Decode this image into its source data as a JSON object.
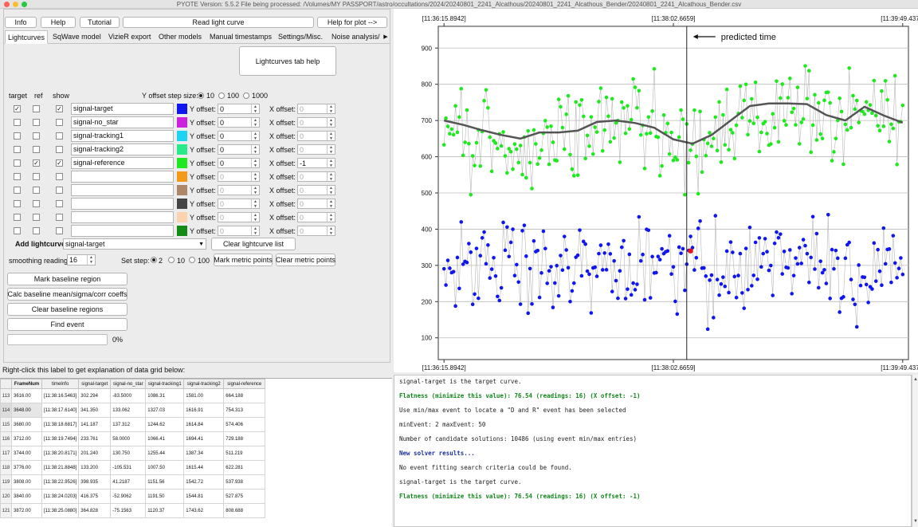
{
  "window": {
    "title": "PYOTE Version: 5.5.2  File being processed: /Volumes/MY PASSPORT/astro/occultations/2024/20240801_2241_Alcathous/20240801_2241_Alcathous_Bender/20240801_2241_Alcathous_Bender.csv"
  },
  "toolbar": {
    "info": "Info",
    "help": "Help",
    "tutorial": "Tutorial",
    "read_lc": "Read light curve",
    "help_plot": "Help for plot -->"
  },
  "tabs": [
    "Lightcurves",
    "SqWave model",
    "VizieR export",
    "Other models",
    "Manual timestamps",
    "Settings/Misc.",
    "Noise analysis/"
  ],
  "lc_help": "Lightcurves tab help",
  "headers": {
    "target": "target",
    "ref": "ref",
    "show": "show",
    "yoffset_step": "Y offset step size:",
    "yoffset_label": "Y offset:",
    "xoffset_label": "X offset:"
  },
  "yoffset_steps": [
    "10",
    "100",
    "1000"
  ],
  "curves": [
    {
      "name": "signal-target",
      "color": "#0f16ee",
      "target": true,
      "ref": false,
      "show": true,
      "yoff": "0",
      "xoff": "0",
      "enabled": true,
      "xen": false
    },
    {
      "name": "signal-no_star",
      "color": "#cc22dd",
      "target": false,
      "ref": false,
      "show": false,
      "yoff": "0",
      "xoff": "0",
      "enabled": true,
      "xen": false
    },
    {
      "name": "signal-tracking1",
      "color": "#1ed2f4",
      "target": false,
      "ref": false,
      "show": false,
      "yoff": "0",
      "xoff": "0",
      "enabled": true,
      "xen": false
    },
    {
      "name": "signal-tracking2",
      "color": "#28ea8a",
      "target": false,
      "ref": false,
      "show": false,
      "yoff": "0",
      "xoff": "0",
      "enabled": true,
      "xen": false
    },
    {
      "name": "signal-reference",
      "color": "#1ee91e",
      "target": false,
      "ref": true,
      "show": true,
      "yoff": "0",
      "xoff": "-1",
      "enabled": true,
      "xen": true
    },
    {
      "name": "",
      "color": "#f39a1a",
      "target": false,
      "ref": false,
      "show": false,
      "yoff": "0",
      "xoff": "0",
      "enabled": false,
      "xen": false
    },
    {
      "name": "",
      "color": "#ae8668",
      "target": false,
      "ref": false,
      "show": false,
      "yoff": "0",
      "xoff": "0",
      "enabled": false,
      "xen": false
    },
    {
      "name": "",
      "color": "#454545",
      "target": false,
      "ref": false,
      "show": false,
      "yoff": "0",
      "xoff": "0",
      "enabled": false,
      "xen": false
    },
    {
      "name": "",
      "color": "#fbd4ae",
      "target": false,
      "ref": false,
      "show": false,
      "yoff": "0",
      "xoff": "0",
      "enabled": false,
      "xen": false
    },
    {
      "name": "",
      "color": "#168a16",
      "target": false,
      "ref": false,
      "show": false,
      "yoff": "0",
      "xoff": "0",
      "enabled": false,
      "xen": false
    }
  ],
  "add_lc": {
    "label": "Add lightcurve",
    "value": "signal-target",
    "clear": "Clear lightcurve list"
  },
  "smoothing": {
    "label": "smoothing readings",
    "value": "16"
  },
  "set_step": {
    "label": "Set step:",
    "options": [
      "2",
      "10",
      "100"
    ]
  },
  "metric": {
    "mark": "Mark metric points",
    "clear": "Clear metric points"
  },
  "actions": {
    "mark_baseline": "Mark baseline region",
    "calc_baseline": "Calc baseline mean/sigma/corr coeffs",
    "clear_baseline": "Clear baseline regions",
    "find_event": "Find event"
  },
  "progress": {
    "text": "0%",
    "value": 0
  },
  "grid_hint": "Right-click this label to get explanation of data grid below:",
  "grid": {
    "columns": [
      "FrameNum",
      "timeInfo",
      "signal-target",
      "signal-no_star",
      "signal-tracking1",
      "signal-tracking2",
      "signal-reference"
    ],
    "rows": [
      {
        "rn": "113",
        "cells": [
          "3616.00",
          "[11:38:16.5463]",
          "302.294",
          "-83.5000",
          "1086.31",
          "1581.00",
          "664.188"
        ]
      },
      {
        "rn": "114",
        "cells": [
          "3648.00",
          "[11:38:17.6140]",
          "341.350",
          "133.062",
          "1327.03",
          "1616.91",
          "754.313"
        ]
      },
      {
        "rn": "115",
        "cells": [
          "3680.00",
          "[11:38:18.6817]",
          "141.187",
          "137.312",
          "1244.62",
          "1614.84",
          "574.406"
        ]
      },
      {
        "rn": "116",
        "cells": [
          "3712.00",
          "[11:38:19.7494]",
          "233.761",
          "58.0000",
          "1066.41",
          "1694.41",
          "729.188"
        ]
      },
      {
        "rn": "117",
        "cells": [
          "3744.00",
          "[11:38:20.8171]",
          "201.240",
          "130.750",
          "1255.44",
          "1387.34",
          "511.219"
        ]
      },
      {
        "rn": "118",
        "cells": [
          "3776.00",
          "[11:38:21.8848]",
          "133.200",
          "-105.531",
          "1007.50",
          "1615.44",
          "622.281"
        ]
      },
      {
        "rn": "119",
        "cells": [
          "3808.00",
          "[11:38:22.9526]",
          "398.935",
          "41.2187",
          "1151.56",
          "1542.72",
          "537.938"
        ]
      },
      {
        "rn": "120",
        "cells": [
          "3840.00",
          "[11:38:24.0203]",
          "416.375",
          "-52.9062",
          "1191.50",
          "1544.81",
          "527.875"
        ]
      },
      {
        "rn": "121",
        "cells": [
          "3872.00",
          "[11:38:25.0880]",
          "364.828",
          "-75.1563",
          "1120.37",
          "1743.62",
          "808.688"
        ]
      }
    ]
  },
  "output": [
    {
      "t": "signal-target is the target curve.",
      "s": "n"
    },
    {
      "t": "Flatness (minimize this value): 76.54 (readings: 16) (X offset: -1)",
      "s": "g"
    },
    {
      "t": "Use min/max event to locate a \"D and R\" event has been selected",
      "s": "n"
    },
    {
      "t": "minEvent: 2 maxEvent: 50",
      "s": "n"
    },
    {
      "t": "Number of candidate solutions: 10486 (using event min/max entries)",
      "s": "n"
    },
    {
      "t": "New solver results...",
      "s": "b"
    },
    {
      "t": "No event fitting search criteria could be found.",
      "s": "n"
    },
    {
      "t": "signal-target is the target curve.",
      "s": "n"
    },
    {
      "t": "Flatness (minimize this value): 76.54 (readings: 16) (X offset: -1)",
      "s": "g"
    }
  ],
  "chart_data": {
    "type": "scatter",
    "top_ticks": [
      "[11:36:15.8942]",
      "[11:38:02.6659]",
      "[11:39:49.4377]"
    ],
    "bottom_ticks": [
      "[11:36:15.8942]",
      "[11:38:02.6659]",
      "[11:39:49.4377]"
    ],
    "y_ticks": [
      100,
      200,
      300,
      400,
      500,
      600,
      700,
      800,
      900
    ],
    "ylim": [
      40,
      960
    ],
    "xlim": [
      -3,
      243
    ],
    "annotation": "predicted time",
    "predicted_frame": 127,
    "highlight_point": {
      "x": 129,
      "y": 340,
      "color": "#ee1111"
    },
    "grid": true,
    "series": [
      {
        "name": "signal-reference",
        "color": "#1ee91e",
        "role": "points"
      },
      {
        "name": "signal-target",
        "color": "#0f16ee",
        "role": "points"
      },
      {
        "name": "signal-reference",
        "color": "#555555",
        "role": "smoothed",
        "x": [
          0,
          10,
          20,
          30,
          40,
          50,
          60,
          70,
          80,
          90,
          100,
          110,
          120,
          130,
          140,
          150,
          160,
          170,
          180,
          190,
          200,
          210,
          220,
          230,
          240
        ],
        "y": [
          700,
          688,
          673,
          660,
          650,
          667,
          667,
          672,
          696,
          700,
          693,
          680,
          648,
          636,
          660,
          700,
          740,
          747,
          747,
          745,
          715,
          700,
          738,
          714,
          694
        ]
      }
    ],
    "seed": 7
  }
}
